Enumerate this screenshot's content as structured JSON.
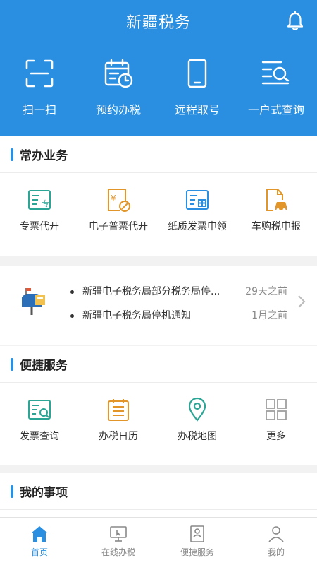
{
  "header": {
    "title": "新疆税务"
  },
  "quick_actions": [
    {
      "label": "扫一扫",
      "icon": "scan-icon"
    },
    {
      "label": "预约办税",
      "icon": "calendar-icon"
    },
    {
      "label": "远程取号",
      "icon": "phone-icon"
    },
    {
      "label": "一户式查询",
      "icon": "list-search-icon"
    }
  ],
  "common": {
    "title": "常办业务",
    "items": [
      {
        "label": "专票代开",
        "icon": "special-invoice-icon"
      },
      {
        "label": "电子普票代开",
        "icon": "e-invoice-icon"
      },
      {
        "label": "纸质发票申领",
        "icon": "paper-invoice-icon"
      },
      {
        "label": "车购税申报",
        "icon": "car-tax-icon"
      }
    ]
  },
  "notices": [
    {
      "text": "新疆电子税务局部分税务局停...",
      "time": "29天之前"
    },
    {
      "text": "新疆电子税务局停机通知",
      "time": "1月之前"
    }
  ],
  "convenient": {
    "title": "便捷服务",
    "items": [
      {
        "label": "发票查询",
        "icon": "invoice-search-icon"
      },
      {
        "label": "办税日历",
        "icon": "tax-calendar-icon"
      },
      {
        "label": "办税地图",
        "icon": "map-pin-icon"
      },
      {
        "label": "更多",
        "icon": "more-grid-icon"
      }
    ]
  },
  "my_items": {
    "title": "我的事项"
  },
  "tabs": [
    {
      "label": "首页",
      "active": true
    },
    {
      "label": "在线办税"
    },
    {
      "label": "便捷服务"
    },
    {
      "label": "我的"
    }
  ],
  "colors": {
    "primary": "#2a8fe0",
    "teal": "#2aa596",
    "orange": "#e2962a",
    "gray_icon": "#9e9e9e"
  }
}
